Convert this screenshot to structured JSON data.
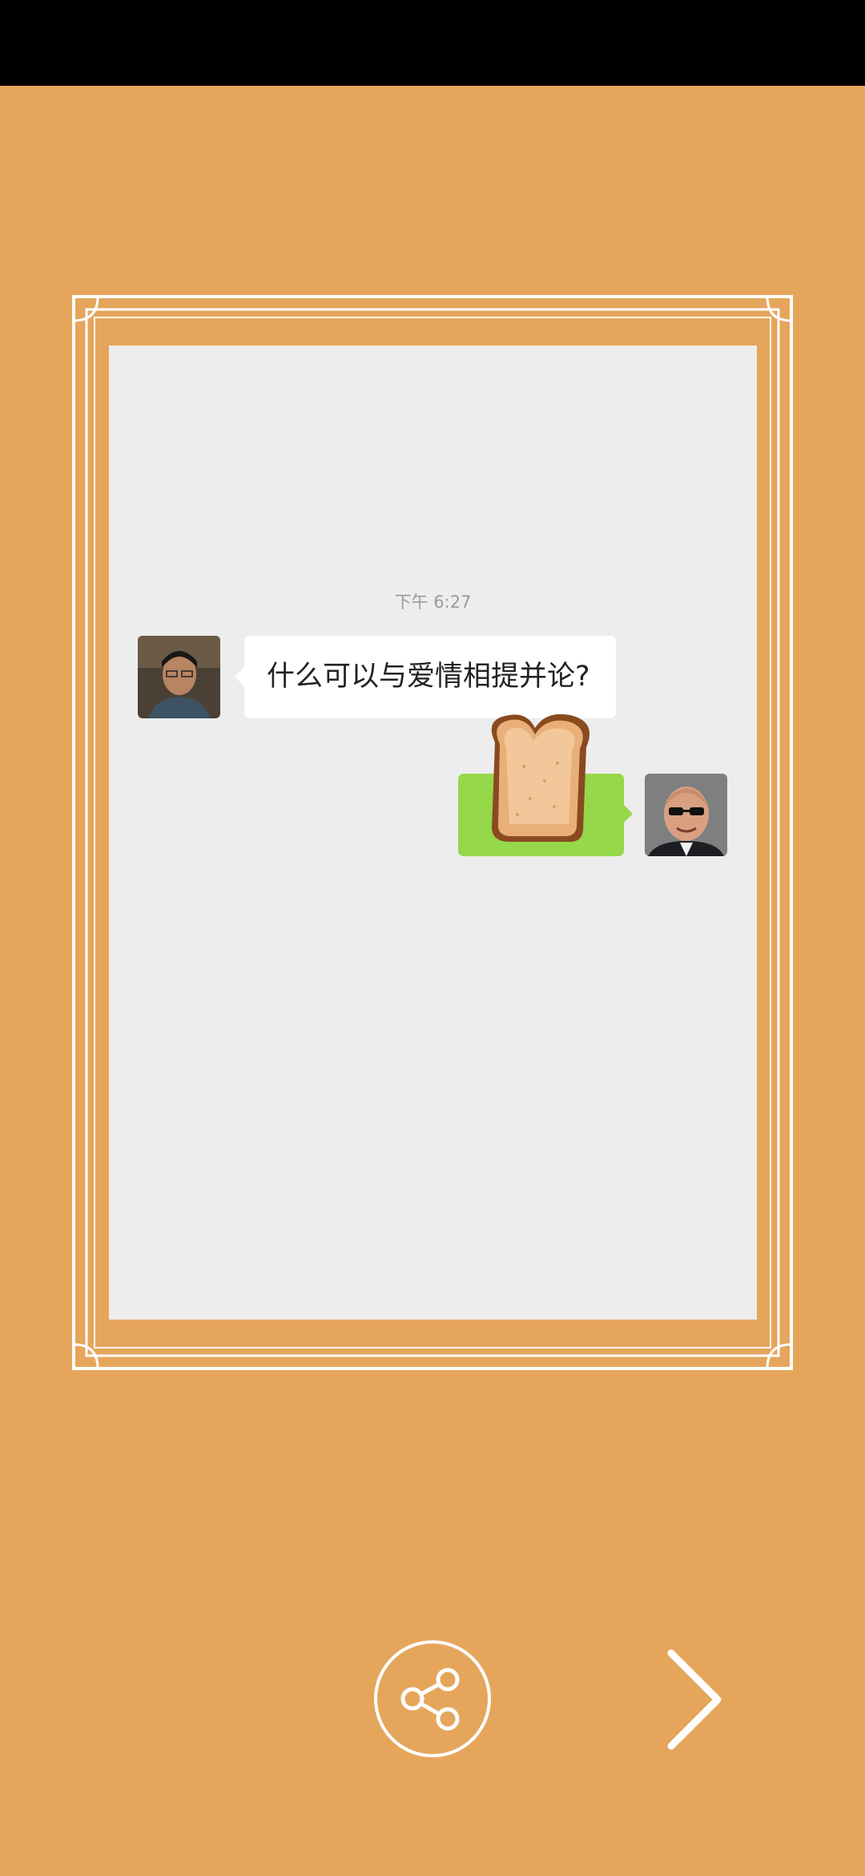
{
  "chat": {
    "timestamp": "下午 6:27",
    "messages": [
      {
        "sender": "left",
        "text": "什么可以与爱情相提并论?"
      },
      {
        "sender": "right",
        "sticker": "toast-bread"
      }
    ]
  },
  "controls": {
    "share_icon": "share-icon",
    "next_icon": "chevron-right-icon"
  },
  "colors": {
    "background": "#E5A65C",
    "frame": "#FFFFFF",
    "chat_background": "#EDEDED",
    "incoming_bubble": "#FFFFFF",
    "outgoing_bubble": "#95D84A"
  }
}
